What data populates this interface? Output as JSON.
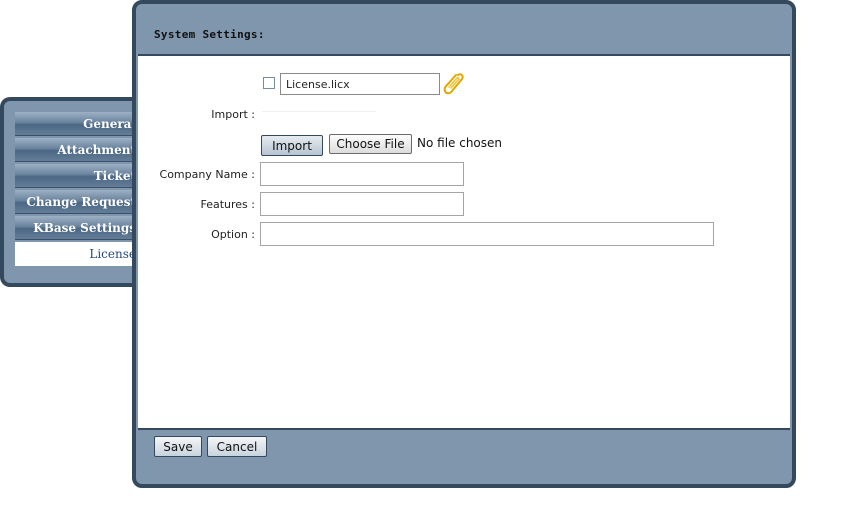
{
  "window": {
    "title": "System Settings:"
  },
  "sidebar": {
    "items": [
      {
        "label": "General"
      },
      {
        "label": "Attachment"
      },
      {
        "label": "Ticket"
      },
      {
        "label": "Change Request"
      },
      {
        "label": "KBase Settings"
      },
      {
        "label": "License"
      }
    ],
    "active": "License"
  },
  "form": {
    "import_label": "Import :",
    "license_file": "License.licx",
    "import_button": "Import",
    "choose_file_button": "Choose File",
    "no_file_text": "No file chosen",
    "company_name_label": "Company Name :",
    "company_name_value": "",
    "features_label": "Features :",
    "features_value": "",
    "option_label": "Option :",
    "option_value": ""
  },
  "footer": {
    "save_label": "Save",
    "cancel_label": "Cancel"
  },
  "icons": {
    "attachment": "paperclip-icon"
  },
  "colors": {
    "panel_bg": "#7f96ad",
    "border": "#34495e",
    "active_tab_text": "#274a7a"
  }
}
